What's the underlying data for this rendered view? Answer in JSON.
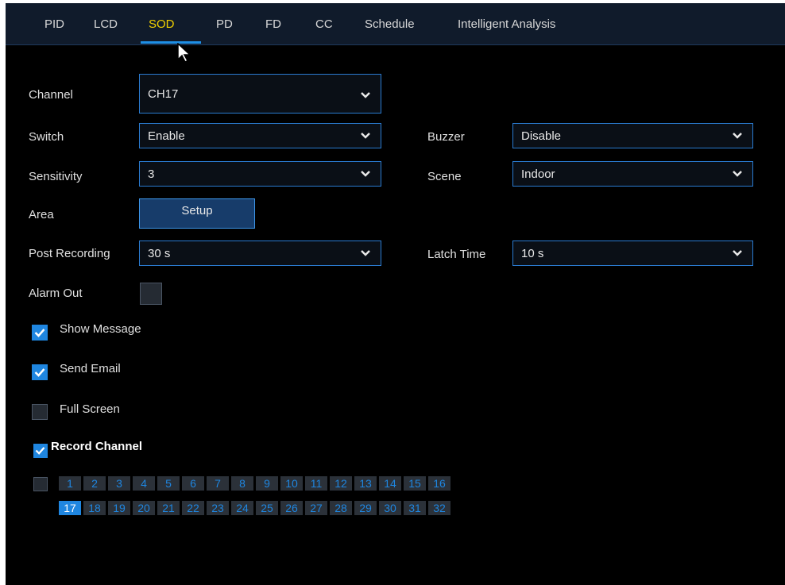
{
  "tabs": [
    {
      "label": "PID"
    },
    {
      "label": "LCD"
    },
    {
      "label": "SOD"
    },
    {
      "label": "PD"
    },
    {
      "label": "FD"
    },
    {
      "label": "CC"
    },
    {
      "label": "Schedule"
    },
    {
      "label": "Intelligent Analysis"
    }
  ],
  "active_tab": "SOD",
  "form": {
    "channel": {
      "label": "Channel",
      "value": "CH17"
    },
    "switch": {
      "label": "Switch",
      "value": "Enable"
    },
    "buzzer": {
      "label": "Buzzer",
      "value": "Disable"
    },
    "sensitivity": {
      "label": "Sensitivity",
      "value": "3"
    },
    "scene": {
      "label": "Scene",
      "value": "Indoor"
    },
    "area": {
      "label": "Area",
      "button": "Setup"
    },
    "post_recording": {
      "label": "Post Recording",
      "value": "30 s"
    },
    "latch_time": {
      "label": "Latch Time",
      "value": "10 s"
    },
    "alarm_out": {
      "label": "Alarm Out",
      "checked": false
    }
  },
  "options": [
    {
      "label": "Show Message",
      "checked": true
    },
    {
      "label": "Send Email",
      "checked": true
    },
    {
      "label": "Full Screen",
      "checked": false
    }
  ],
  "record_channel": {
    "label": "Record Channel",
    "checked": true,
    "select_all_checked": false,
    "channels_row1": [
      "1",
      "2",
      "3",
      "4",
      "5",
      "6",
      "7",
      "8",
      "9",
      "10",
      "11",
      "12",
      "13",
      "14",
      "15",
      "16"
    ],
    "channels_row2": [
      "17",
      "18",
      "19",
      "20",
      "21",
      "22",
      "23",
      "24",
      "25",
      "26",
      "27",
      "28",
      "29",
      "30",
      "31",
      "32"
    ],
    "selected": [
      "17"
    ]
  },
  "colors": {
    "accent": "#1f86e0",
    "active_tab": "#f0d000",
    "background": "#000000"
  }
}
